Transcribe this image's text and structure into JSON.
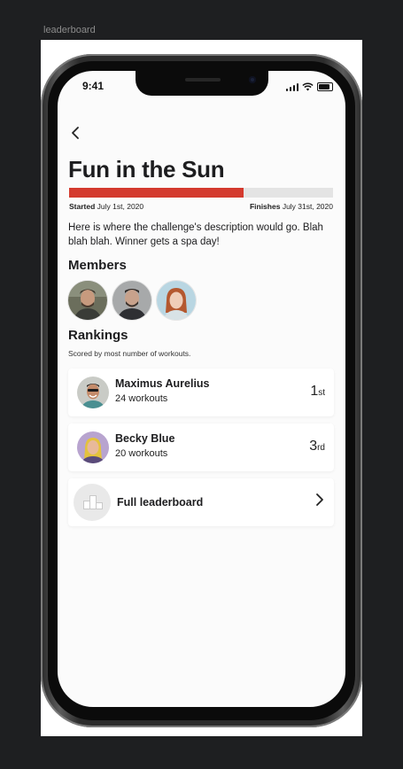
{
  "canvas": {
    "label": "leaderboard"
  },
  "status_bar": {
    "time": "9:41"
  },
  "challenge": {
    "title": "Fun in the Sun",
    "progress_fraction": 0.66,
    "started_label": "Started",
    "started_date": "July 1st, 2020",
    "finishes_label": "Finishes",
    "finishes_date": "July 31st, 2020",
    "description": "Here is where the challenge's description would go. Blah blah blah. Winner gets a spa day!",
    "accent_color": "#d43a2e"
  },
  "members": {
    "title": "Members",
    "avatars": [
      "member-avatar-1",
      "member-avatar-2",
      "member-avatar-3"
    ]
  },
  "rankings": {
    "title": "Rankings",
    "subtitle": "Scored by most number of workouts.",
    "items": [
      {
        "name": "Maximus Aurelius",
        "workouts": "24 workouts",
        "rank_num": "1",
        "rank_suffix": "st"
      },
      {
        "name": "Becky Blue",
        "workouts": "20 workouts",
        "rank_num": "3",
        "rank_suffix": "rd"
      }
    ],
    "full_leaderboard_label": "Full leaderboard"
  }
}
